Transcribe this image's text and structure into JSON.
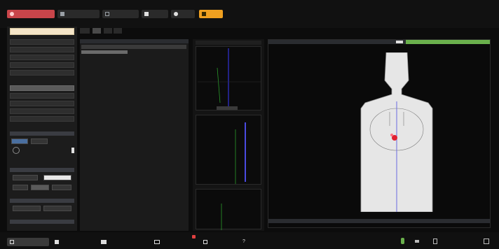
{
  "toolbar": {
    "buttons": [
      {
        "icon": "record-icon",
        "color": "#d9534f"
      },
      {
        "icon": "image-icon"
      },
      {
        "icon": "grid-icon"
      },
      {
        "icon": "layers-icon"
      },
      {
        "icon": "settings-icon"
      },
      {
        "icon": "warning-icon",
        "color": "#f0a020"
      }
    ]
  },
  "left_panel": {
    "input_value": "",
    "menu_items": [
      "",
      "",
      "",
      "",
      "",
      "",
      "",
      "",
      "",
      ""
    ],
    "selected_index": 6
  },
  "table_panel": {
    "title": "",
    "tabs": [
      "",
      "",
      ""
    ]
  },
  "viewer": {
    "title": "",
    "status_badge_color": "#6ab04c"
  },
  "bottombar": {
    "buttons": [
      {
        "icon": "monitor-icon"
      },
      {
        "icon": "pen-icon"
      },
      {
        "icon": "chart-icon"
      },
      {
        "icon": "camera-icon"
      },
      {
        "icon": "save-icon"
      },
      {
        "icon": "help-icon"
      }
    ],
    "right_icons": [
      "mic-icon",
      "volume-icon",
      "trash-icon",
      "expand-icon"
    ]
  }
}
